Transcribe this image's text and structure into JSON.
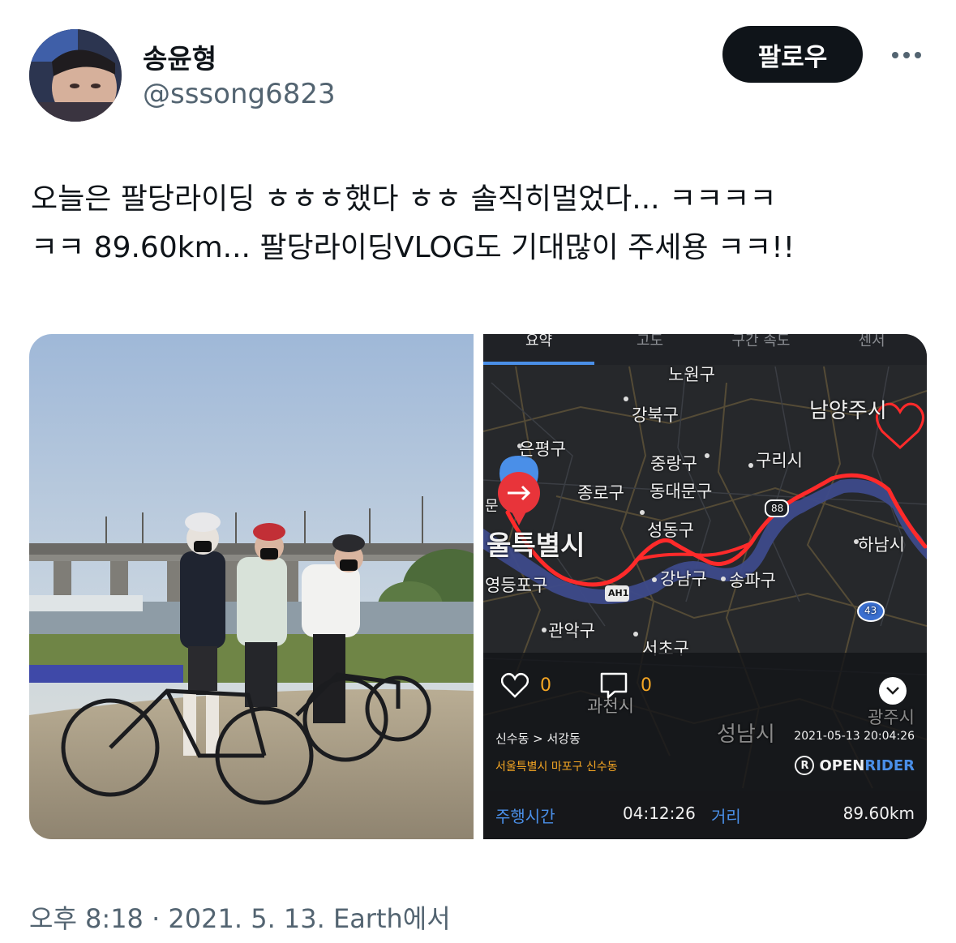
{
  "user": {
    "display_name": "송윤형",
    "handle": "@sssong6823"
  },
  "actions": {
    "follow_label": "팔로우",
    "more_icon": "more-horizontal-icon"
  },
  "tweet": {
    "lines": [
      "오늘은 팔당라이딩 ㅎㅎㅎ했다 ㅎㅎ 솔직히멀었다... ㅋㅋㅋㅋ",
      "ㅋㅋ 89.60km... 팔당라이딩VLOG도 기대많이 주세용 ㅋㅋ!!"
    ]
  },
  "ride_app": {
    "tabs": [
      "요약",
      "고도",
      "구간 속도",
      "센서"
    ],
    "active_tab": "요약",
    "map_labels": {
      "dobong": "노원구",
      "gangbuk": "강북구",
      "namyangju": "남양주시",
      "eunpyeong": "은평구",
      "jungnang": "중랑구",
      "guri": "구리시",
      "jongno": "종로구",
      "dongdaemun": "동대문구",
      "seoul": "울특별시",
      "seoul_prefix": "문",
      "seongdong": "성동구",
      "hanam": "하남시",
      "gangnam": "강남구",
      "songpa": "송파구",
      "yeongdeungpo": "영등포구",
      "gwanak": "관악구",
      "seocho": "서초구",
      "gwacheon": "과천시",
      "seongnam": "성남시",
      "gwangju": "광주시",
      "road_88": "88",
      "road_ah1": "AH1",
      "road_43": "43"
    },
    "likes": "0",
    "comments": "0",
    "route": "신수동 > 서강동",
    "location": "서울특별시 마포구 신수동",
    "datetime": "2021-05-13 20:04:26",
    "brand_logo": "R",
    "brand_open": "OPEN",
    "brand_rider": "RIDER",
    "ride_time_label": "주행시간",
    "ride_time": "04:12:26",
    "distance_label": "거리",
    "distance": "89.60km",
    "colors": {
      "route": "#ff2a2a",
      "accent_blue": "#4a8fe8",
      "accent_orange": "#f5a623"
    }
  },
  "meta": {
    "timestamp": "오후 8:18 · 2021. 5. 13. Earth에서"
  }
}
